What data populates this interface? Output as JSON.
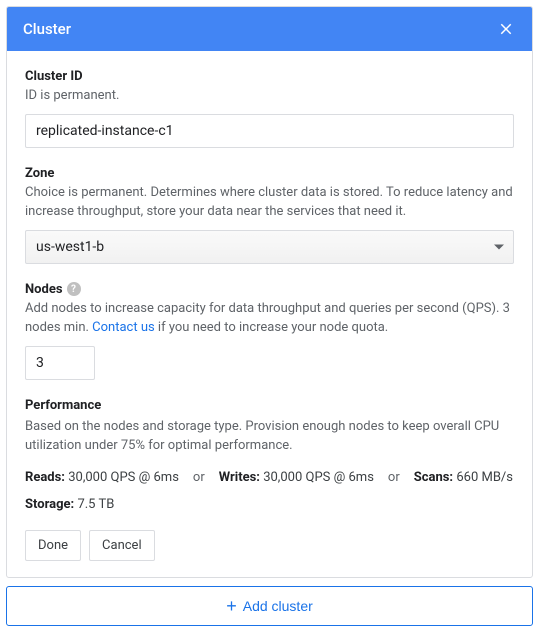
{
  "header": {
    "title": "Cluster"
  },
  "cluster_id": {
    "label": "Cluster ID",
    "help": "ID is permanent.",
    "value": "replicated-instance-c1"
  },
  "zone": {
    "label": "Zone",
    "help": "Choice is permanent. Determines where cluster data is stored. To reduce latency and increase throughput, store your data near the services that need it.",
    "value": "us-west1-b"
  },
  "nodes": {
    "label": "Nodes",
    "help_prefix": "Add nodes to increase capacity for data throughput and queries per second (QPS). 3 nodes min. ",
    "help_link": "Contact us",
    "help_suffix": " if you need to increase your node quota.",
    "value": "3"
  },
  "performance": {
    "label": "Performance",
    "help": "Based on the nodes and storage type. Provision enough nodes to keep overall CPU utilization under 75% for optimal performance.",
    "reads_label": "Reads:",
    "reads_value": "30,000 QPS @ 6ms",
    "writes_label": "Writes:",
    "writes_value": "30,000 QPS @ 6ms",
    "scans_label": "Scans:",
    "scans_value": "660 MB/s",
    "or": "or",
    "storage_label": "Storage:",
    "storage_value": "7.5 TB"
  },
  "buttons": {
    "done": "Done",
    "cancel": "Cancel",
    "add_cluster": "Add cluster"
  }
}
